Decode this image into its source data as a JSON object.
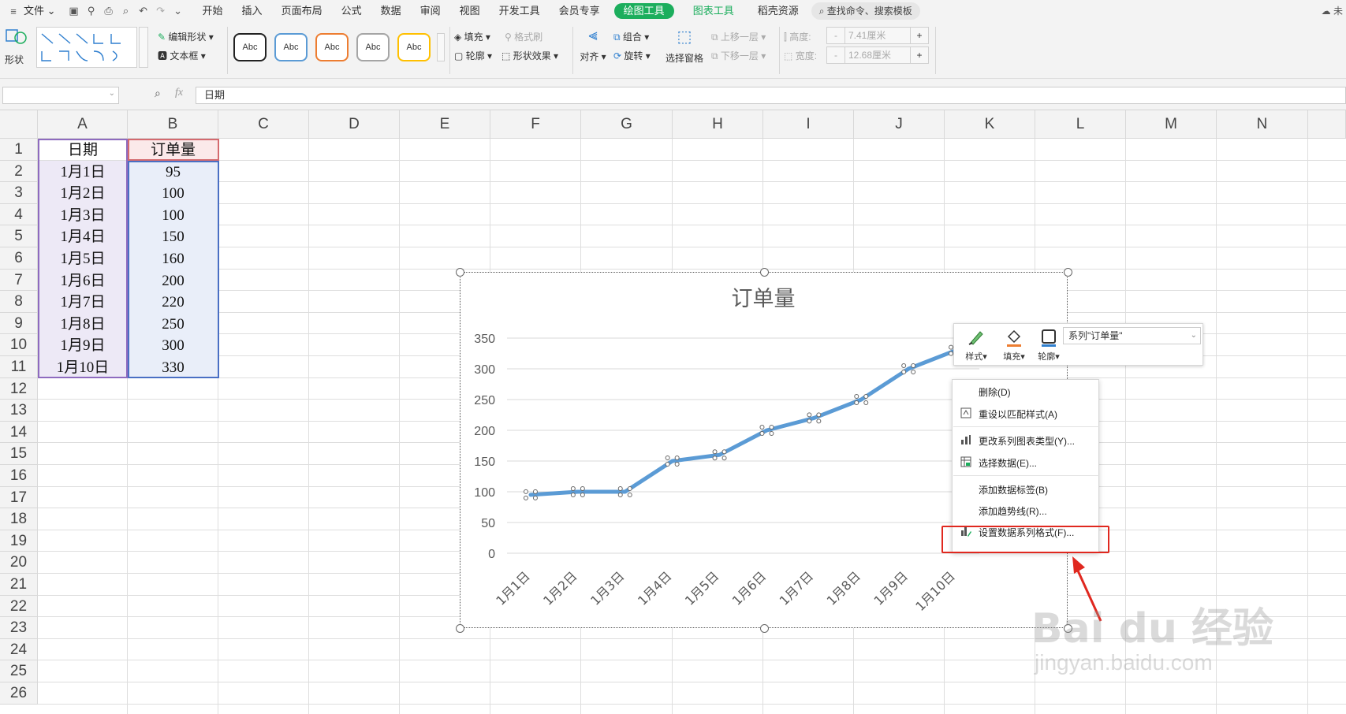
{
  "menubar": {
    "file_label": "文件",
    "tabs": [
      "开始",
      "插入",
      "页面布局",
      "公式",
      "数据",
      "审阅",
      "视图",
      "开发工具",
      "会员专享"
    ],
    "draw_tools_label": "绘图工具",
    "chart_tools_label": "图表工具",
    "template_label": "稻壳资源",
    "search_label": "查找命令、搜索模板",
    "cloud_label": "未"
  },
  "ribbon": {
    "shape_label": "形状",
    "edit_shape_label": "编辑形状",
    "textbox_label": "文本框",
    "style_samples": [
      "Abc",
      "Abc",
      "Abc",
      "Abc",
      "Abc"
    ],
    "fill_label": "填充",
    "format_painter_label": "格式刷",
    "outline_label": "轮廓",
    "shape_effect_label": "形状效果",
    "align_label": "对齐",
    "group_label": "组合",
    "rotate_label": "旋转",
    "select_pane_label": "选择窗格",
    "bring_forward_label": "上移一层",
    "send_backward_label": "下移一层",
    "height_label": "高度:",
    "height_value": "7.41厘米",
    "width_label": "宽度:",
    "width_value": "12.68厘米",
    "spin_plus": "+",
    "spin_minus": "-"
  },
  "formula_bar": {
    "fx_label": "fx",
    "content": "日期"
  },
  "sheet": {
    "columns": [
      "A",
      "B",
      "C",
      "D",
      "E",
      "F",
      "G",
      "H",
      "I",
      "J",
      "K",
      "L",
      "M",
      "N"
    ],
    "rows": [
      "1",
      "2",
      "3",
      "4",
      "5",
      "6",
      "7",
      "8",
      "9",
      "10",
      "11",
      "12",
      "13",
      "14",
      "15",
      "16",
      "17",
      "18",
      "19",
      "20",
      "21",
      "22",
      "23",
      "24",
      "25",
      "26"
    ],
    "header_date": "日期",
    "header_orders": "订单量",
    "dates": [
      "1月1日",
      "1月2日",
      "1月3日",
      "1月4日",
      "1月5日",
      "1月6日",
      "1月7日",
      "1月8日",
      "1月9日",
      "1月10日"
    ],
    "orders": [
      "95",
      "100",
      "100",
      "150",
      "160",
      "200",
      "220",
      "250",
      "300",
      "330"
    ]
  },
  "chart_data": {
    "type": "line",
    "title": "订单量",
    "categories": [
      "1月1日",
      "1月2日",
      "1月3日",
      "1月4日",
      "1月5日",
      "1月6日",
      "1月7日",
      "1月8日",
      "1月9日",
      "1月10日"
    ],
    "series": [
      {
        "values": [
          95,
          100,
          100,
          150,
          160,
          200,
          220,
          250,
          300,
          330
        ]
      }
    ],
    "y_ticks": [
      "0",
      "50",
      "100",
      "150",
      "200",
      "250",
      "300",
      "350"
    ],
    "ylim": [
      0,
      350
    ],
    "grid": true,
    "line_color": "#5b9bd5"
  },
  "floatbar": {
    "style_label": "样式",
    "fill_label": "填充",
    "outline_label": "轮廓",
    "series_select": "系列\"订单量\""
  },
  "context_menu": {
    "items": [
      "删除(D)",
      "重设以匹配样式(A)",
      "更改系列图表类型(Y)...",
      "选择数据(E)...",
      "添加数据标签(B)",
      "添加趋势线(R)...",
      "设置数据系列格式(F)..."
    ]
  },
  "watermark": {
    "brand": "Bai du 经验",
    "url": "jingyan.baidu.com"
  },
  "colors": {
    "accent_green": "#1cae5d",
    "highlight_red": "#e0281f",
    "series_blue": "#5b9bd5"
  }
}
